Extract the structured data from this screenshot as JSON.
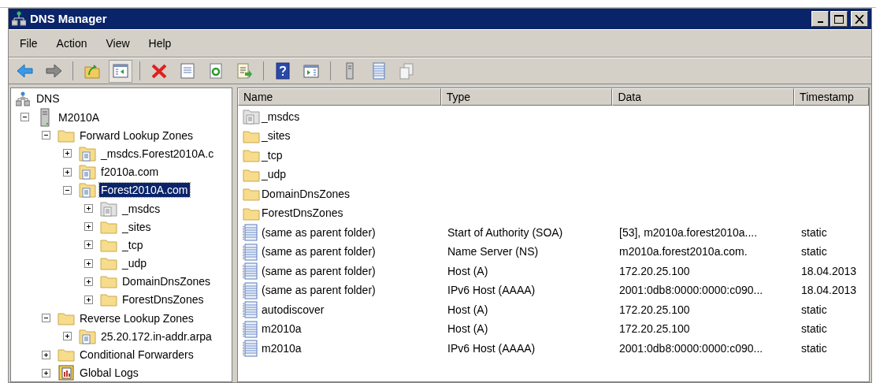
{
  "window": {
    "title": "DNS Manager"
  },
  "menu": [
    "File",
    "Action",
    "View",
    "Help"
  ],
  "toolbar": [
    {
      "kind": "back",
      "pressed": false
    },
    {
      "kind": "forward",
      "pressed": false
    },
    {
      "kind": "separator"
    },
    {
      "kind": "up",
      "pressed": false
    },
    {
      "kind": "tree-toggle",
      "pressed": true
    },
    {
      "kind": "separator"
    },
    {
      "kind": "delete",
      "pressed": false
    },
    {
      "kind": "properties",
      "pressed": false
    },
    {
      "kind": "refresh",
      "pressed": false
    },
    {
      "kind": "export",
      "pressed": false
    },
    {
      "kind": "separator"
    },
    {
      "kind": "help",
      "pressed": false
    },
    {
      "kind": "action-pane",
      "pressed": false
    },
    {
      "kind": "separator"
    },
    {
      "kind": "server",
      "pressed": false
    },
    {
      "kind": "record",
      "pressed": false
    },
    {
      "kind": "copy",
      "pressed": false
    }
  ],
  "tree": [
    {
      "label": "DNS",
      "kind": "dns",
      "selected": false,
      "children": [
        {
          "label": "M2010A",
          "kind": "server",
          "expanded": true,
          "selected": false,
          "children": [
            {
              "label": "Forward Lookup Zones",
              "kind": "folder",
              "expanded": true,
              "selected": false,
              "children": [
                {
                  "label": "_msdcs.Forest2010A.c",
                  "kind": "zone",
                  "expanded": false,
                  "selected": false
                },
                {
                  "label": "f2010a.com",
                  "kind": "zone",
                  "expanded": false,
                  "selected": false
                },
                {
                  "label": "Forest2010A.com",
                  "kind": "zone",
                  "expanded": true,
                  "selected": true,
                  "children": [
                    {
                      "label": "_msdcs",
                      "kind": "zone-grey",
                      "expanded": false,
                      "selected": false
                    },
                    {
                      "label": "_sites",
                      "kind": "folder",
                      "expanded": false,
                      "selected": false
                    },
                    {
                      "label": "_tcp",
                      "kind": "folder",
                      "expanded": false,
                      "selected": false
                    },
                    {
                      "label": "_udp",
                      "kind": "folder",
                      "expanded": false,
                      "selected": false
                    },
                    {
                      "label": "DomainDnsZones",
                      "kind": "folder",
                      "expanded": false,
                      "selected": false
                    },
                    {
                      "label": "ForestDnsZones",
                      "kind": "folder",
                      "expanded": false,
                      "selected": false
                    }
                  ]
                }
              ]
            },
            {
              "label": "Reverse Lookup Zones",
              "kind": "folder",
              "expanded": true,
              "selected": false,
              "children": [
                {
                  "label": "25.20.172.in-addr.arpa",
                  "kind": "zone",
                  "expanded": false,
                  "selected": false
                }
              ]
            },
            {
              "label": "Conditional Forwarders",
              "kind": "folder",
              "expanded": false,
              "selected": false
            },
            {
              "label": "Global Logs",
              "kind": "logs",
              "expanded": false,
              "selected": false
            }
          ]
        }
      ]
    }
  ],
  "table": {
    "columns": [
      "Name",
      "Type",
      "Data",
      "Timestamp"
    ],
    "rows": [
      {
        "kind": "zone-grey",
        "cells": [
          "_msdcs"
        ]
      },
      {
        "kind": "folder",
        "cells": [
          "_sites"
        ]
      },
      {
        "kind": "folder",
        "cells": [
          "_tcp"
        ]
      },
      {
        "kind": "folder",
        "cells": [
          "_udp"
        ]
      },
      {
        "kind": "folder",
        "cells": [
          "DomainDnsZones"
        ]
      },
      {
        "kind": "folder",
        "cells": [
          "ForestDnsZones"
        ]
      },
      {
        "kind": "record",
        "cells": [
          "(same as parent folder)",
          "Start of Authority (SOA)",
          "[53], m2010a.forest2010a....",
          "static"
        ]
      },
      {
        "kind": "record",
        "cells": [
          "(same as parent folder)",
          "Name Server (NS)",
          "m2010a.forest2010a.com.",
          "static"
        ]
      },
      {
        "kind": "record",
        "cells": [
          "(same as parent folder)",
          "Host (A)",
          "172.20.25.100",
          "18.04.2013"
        ]
      },
      {
        "kind": "record",
        "cells": [
          "(same as parent folder)",
          "IPv6 Host (AAAA)",
          "2001:0db8:0000:0000:c090...",
          "18.04.2013"
        ]
      },
      {
        "kind": "record",
        "cells": [
          "autodiscover",
          "Host (A)",
          "172.20.25.100",
          "static"
        ]
      },
      {
        "kind": "record",
        "cells": [
          "m2010a",
          "Host (A)",
          "172.20.25.100",
          "static"
        ]
      },
      {
        "kind": "record",
        "cells": [
          "m2010a",
          "IPv6 Host (AAAA)",
          "2001:0db8:0000:0000:c090...",
          "static"
        ]
      }
    ]
  }
}
